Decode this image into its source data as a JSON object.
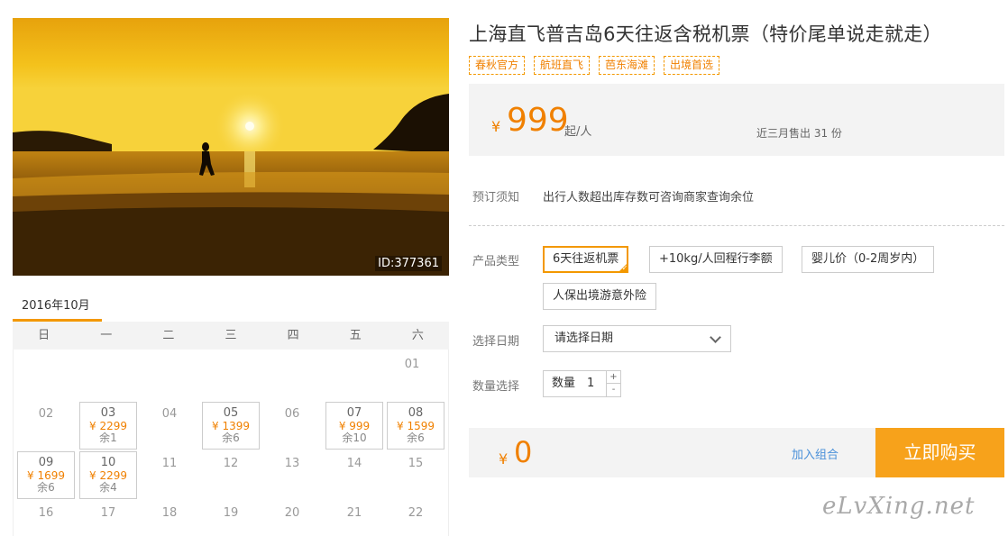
{
  "photo": {
    "id_label": "ID:377361"
  },
  "calendar": {
    "month_tab": "2016年10月",
    "weekdays": [
      "日",
      "一",
      "二",
      "三",
      "四",
      "五",
      "六"
    ],
    "days": [
      {
        "day": "01"
      },
      {
        "day": "02"
      },
      {
        "day": "03",
        "price": "¥ 2299",
        "remain": "余1"
      },
      {
        "day": "04"
      },
      {
        "day": "05",
        "price": "¥ 1399",
        "remain": "余6"
      },
      {
        "day": "06"
      },
      {
        "day": "07",
        "price": "¥ 999",
        "remain": "余10"
      },
      {
        "day": "08",
        "price": "¥ 1599",
        "remain": "余6"
      },
      {
        "day": "09",
        "price": "¥ 1699",
        "remain": "余6"
      },
      {
        "day": "10",
        "price": "¥ 2299",
        "remain": "余4"
      },
      {
        "day": "11"
      },
      {
        "day": "12"
      },
      {
        "day": "13"
      },
      {
        "day": "14"
      },
      {
        "day": "15"
      },
      {
        "day": "16"
      },
      {
        "day": "17"
      },
      {
        "day": "18"
      },
      {
        "day": "19"
      },
      {
        "day": "20"
      },
      {
        "day": "21"
      },
      {
        "day": "22"
      }
    ]
  },
  "product": {
    "title": "上海直飞普吉岛6天往返含税机票（特价尾单说走就走）",
    "tags": [
      "春秋官方",
      "航班直飞",
      "芭东海滩",
      "出境首选"
    ]
  },
  "price": {
    "currency": "¥",
    "amount": "999",
    "unit": "起/人",
    "sold_text": "近三月售出 31 份"
  },
  "notice": {
    "label": "预订须知",
    "text": "出行人数超出库存数可咨询商家查询余位"
  },
  "options": {
    "label": "产品类型",
    "items": [
      "6天往返机票",
      "+10kg/人回程行李额",
      "婴儿价（0-2周岁内）",
      "人保出境游意外险"
    ],
    "selected_index": 0
  },
  "date": {
    "label": "选择日期",
    "placeholder": "请选择日期"
  },
  "quantity": {
    "label": "数量选择",
    "prefix": "数量",
    "value": "1",
    "plus": "+",
    "minus": "-"
  },
  "checkout": {
    "currency": "¥",
    "total": "0",
    "combo_link": "加入组合",
    "buy_label": "立即购买"
  },
  "watermark": "eLvXing.net",
  "colors": {
    "accent": "#f39800",
    "price": "#f08000",
    "link": "#4a90d9"
  }
}
